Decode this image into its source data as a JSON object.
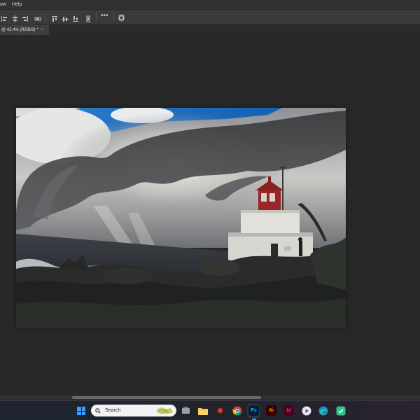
{
  "menu": {
    "items": [
      "ow",
      "Help"
    ]
  },
  "options_bar": {
    "more_label": "•••"
  },
  "document_tab": {
    "title": "@ 42.4% (RGB/8) *",
    "close_label": "×"
  },
  "taskbar": {
    "search_placeholder": "Search",
    "apps": [
      {
        "name": "file-explorer",
        "label": ""
      },
      {
        "name": "folder",
        "label": ""
      },
      {
        "name": "app-red",
        "label": ""
      },
      {
        "name": "chrome",
        "label": ""
      },
      {
        "name": "photoshop",
        "label": "Ps"
      },
      {
        "name": "illustrator",
        "label": "Ai"
      },
      {
        "name": "indesign",
        "label": "Id"
      },
      {
        "name": "media-player",
        "label": ""
      },
      {
        "name": "edge",
        "label": ""
      },
      {
        "name": "security-app",
        "label": ""
      }
    ]
  },
  "colors": {
    "ps_bg": "#001e36",
    "ps_fg": "#31a8ff",
    "ai_bg": "#330000",
    "ai_fg": "#ff9a00",
    "id_bg": "#49021f",
    "id_fg": "#ff3366",
    "accent": "#4aa3ff"
  }
}
